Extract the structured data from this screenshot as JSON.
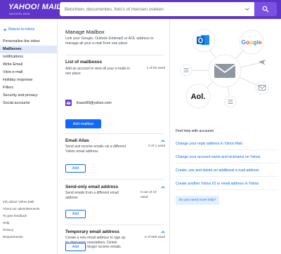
{
  "header": {
    "logo": "YAHOO! MAIL",
    "logo_region": "NEDERLAND",
    "search_placeholder": "Berichten, documenten, foto's of mensen zoeken",
    "search_icon": "search-icon",
    "brand_color": "#5e34c9"
  },
  "sidebar": {
    "back_label": "Return to inbox",
    "items": [
      {
        "label": "Personalize the inbox"
      },
      {
        "label": "Mailboxes",
        "active": true
      },
      {
        "label": "notifications"
      },
      {
        "label": "Write Email"
      },
      {
        "label": "View e-mail"
      },
      {
        "label": "Holiday response"
      },
      {
        "label": "Filters"
      },
      {
        "label": "Security and privacy"
      },
      {
        "label": "Social accounts"
      }
    ],
    "footer": [
      {
        "label": "Info about Yahoo Mail"
      },
      {
        "label": "About our advertisements"
      },
      {
        "label": "To give feedback"
      },
      {
        "label": "Help"
      },
      {
        "label": "Privacy"
      },
      {
        "label": "Requirements"
      }
    ]
  },
  "main": {
    "title": "Manage Mailbox",
    "description": "Link your Google, Outlook (Hotmail) or AOL address to manage all your e-mail from one place.",
    "mailboxes": {
      "title": "List of mailboxes",
      "description": "Add an account to view all your e-mails in one place",
      "count": "1 of 50 used",
      "account_email": "lisazo89@yahoo.com",
      "add_button": "Add mailbox"
    },
    "alias": {
      "title": "Email Alias",
      "description": "Send and receive emails via a different Yahoo email address",
      "count": "0 of 1 used",
      "add_button": "Add"
    },
    "send_only": {
      "title": "Send-only email address",
      "description": "Send emails from a different email address",
      "count": "0 out of 10 used",
      "add_button": "Add"
    },
    "temporary": {
      "title": "Temporary email address",
      "description": "Create a new email address to sign up for third-party newsletters. Delete account to no longer receive emails.",
      "count": "0 of 500 used",
      "add_button": "Add"
    }
  },
  "right": {
    "diagram": {
      "google_label": "Google",
      "aol_label": "Aol.",
      "icons": [
        "outlook-icon",
        "google-icon",
        "aol-icon",
        "envelope-icon",
        "airplane-icon",
        "list-icon",
        "list-icon"
      ]
    },
    "help_title": "Find help with accounts",
    "links": [
      {
        "label": "Change your reply address in Yahoo Mail"
      },
      {
        "label": "Change your account name and nickname on Yahoo"
      },
      {
        "label": "Create, use and delete an additional e-mail address"
      },
      {
        "label": "Create another Yahoo ID or email address in Yahoo"
      }
    ],
    "more_help_button": "Do you need more help?"
  },
  "colors": {
    "link": "#0f69ff",
    "active_sidebar": "#dfe8f8",
    "outlook": "#0a64c8",
    "google_blue": "#4285f4",
    "google_red": "#ea4335",
    "google_yellow": "#fbbc05",
    "google_green": "#34a853"
  }
}
